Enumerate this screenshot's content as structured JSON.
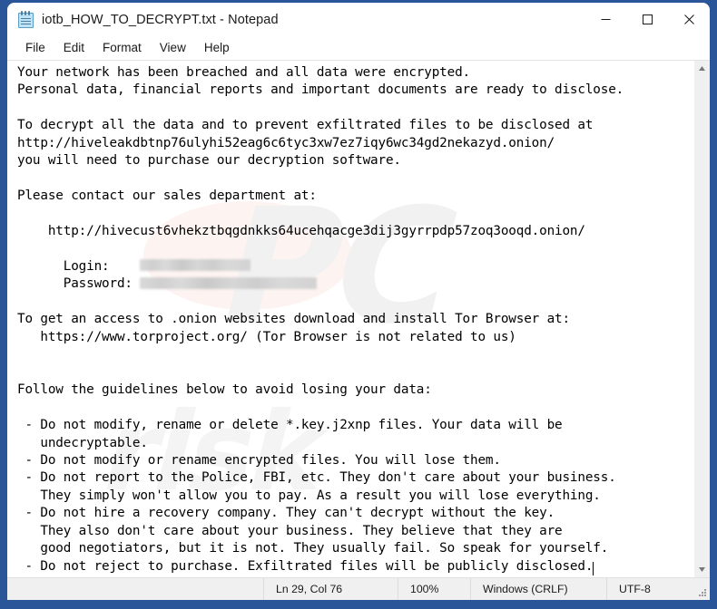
{
  "window": {
    "title": "iotb_HOW_TO_DECRYPT.txt - Notepad",
    "icon": "notepad-icon",
    "controls": {
      "minimize": "minimize-icon",
      "maximize": "maximize-icon",
      "close": "close-icon"
    }
  },
  "menubar": {
    "items": [
      {
        "label": "File"
      },
      {
        "label": "Edit"
      },
      {
        "label": "Format"
      },
      {
        "label": "View"
      },
      {
        "label": "Help"
      }
    ]
  },
  "document": {
    "filename": "iotb_HOW_TO_DECRYPT.txt",
    "lines_before_credentials": "Your network has been breached and all data were encrypted.\nPersonal data, financial reports and important documents are ready to disclose.\n\nTo decrypt all the data and to prevent exfiltrated files to be disclosed at\nhttp://hiveleakdbtnp76ulyhi52eag6c6tyc3xw7ez7iqy6wc34gd2nekazyd.onion/\nyou will need to purchase our decryption software.\n\nPlease contact our sales department at:\n\n    http://hivecust6vhekztbqgdnkks64ucehqacge3dij3gyrrpdp57zoq3ooqd.onion/\n\n",
    "login_label": "      Login:    ",
    "login_value_redacted": true,
    "password_label": "      Password: ",
    "password_value_redacted": true,
    "lines_after_credentials": "\n\nTo get an access to .onion websites download and install Tor Browser at:\n   https://www.torproject.org/ (Tor Browser is not related to us)\n\n\nFollow the guidelines below to avoid losing your data:\n\n - Do not modify, rename or delete *.key.j2xnp files. Your data will be\n   undecryptable.\n - Do not modify or rename encrypted files. You will lose them.\n - Do not report to the Police, FBI, etc. They don't care about your business.\n   They simply won't allow you to pay. As a result you will lose everything.\n - Do not hire a recovery company. They can't decrypt without the key.\n   They also don't care about your business. They believe that they are\n   good negotiators, but it is not. They usually fail. So speak for yourself.\n - Do not reject to purchase. Exfiltrated files will be publicly disclosed.",
    "leak_site_url": "http://hiveleakdbtnp76ulyhi52eag6c6tyc3xw7ez7iqy6wc34gd2nekazyd.onion/",
    "sales_site_url": "http://hivecust6vhekztbqgdnkks64ucehqacge3dij3gyrrpdp57zoq3ooqd.onion/",
    "tor_url": "https://www.torproject.org/",
    "encrypted_extension": "*.key.j2xnp"
  },
  "watermark": {
    "text": "PC",
    "text2": "risk"
  },
  "scrollbar": {
    "up_arrow": "scroll-up-icon",
    "down_arrow": "scroll-down-icon"
  },
  "statusbar": {
    "position": "Ln 29, Col 76",
    "zoom": "100%",
    "line_ending": "Windows (CRLF)",
    "encoding": "UTF-8"
  },
  "colors": {
    "desktop_blue": "#2a5699",
    "window_bg": "#ffffff",
    "statusbar_bg": "#f0f0f0",
    "text": "#000000"
  }
}
